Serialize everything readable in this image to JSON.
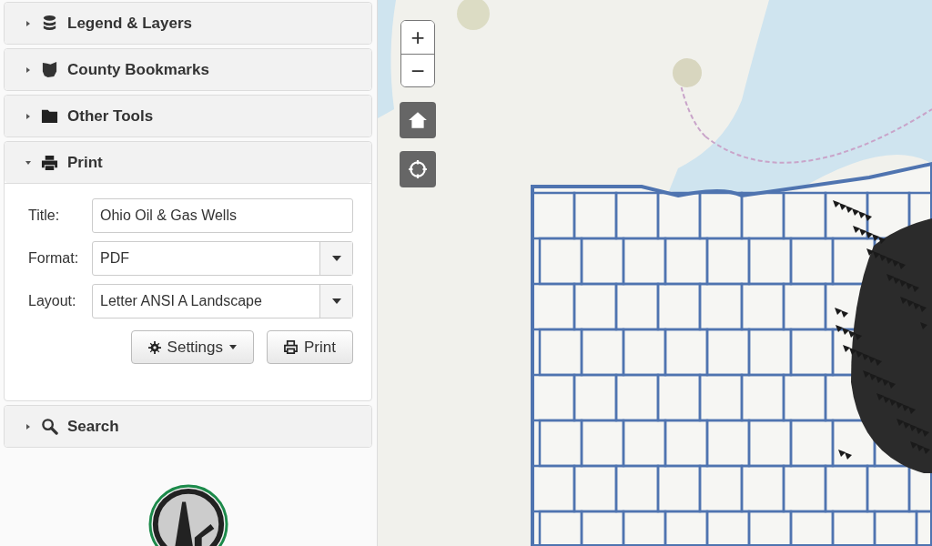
{
  "sidebar": {
    "panels": [
      {
        "title": "Legend & Layers",
        "expanded": false
      },
      {
        "title": "County Bookmarks",
        "expanded": false
      },
      {
        "title": "Other Tools",
        "expanded": false
      },
      {
        "title": "Print",
        "expanded": true,
        "form": {
          "fields": [
            {
              "label": "Title:",
              "kind": "text",
              "value": "Ohio Oil & Gas Wells"
            },
            {
              "label": "Format:",
              "kind": "select",
              "value": "PDF"
            },
            {
              "label": "Layout:",
              "kind": "select",
              "value": "Letter ANSI A Landscape"
            }
          ],
          "buttons": [
            {
              "label": "Settings",
              "kind": "settings"
            },
            {
              "label": "Print",
              "kind": "print"
            }
          ]
        }
      },
      {
        "title": "Search",
        "expanded": false
      }
    ]
  },
  "map": {
    "zoom_in": "+",
    "zoom_out": "−"
  }
}
